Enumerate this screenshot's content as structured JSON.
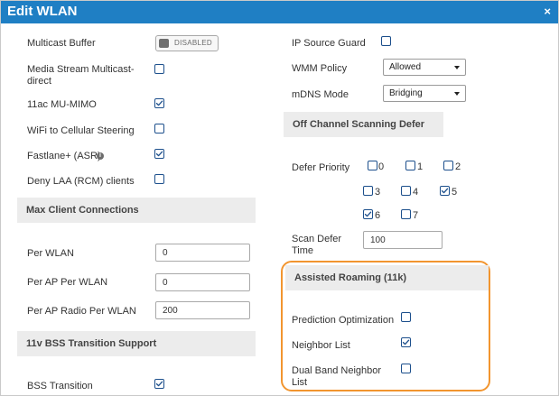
{
  "dialog": {
    "title": "Edit WLAN",
    "close_glyph": "×"
  },
  "left": {
    "multicast_buffer": {
      "label": "Multicast Buffer",
      "toggle_text": "DISABLED",
      "enabled": false
    },
    "media_stream": {
      "label": "Media Stream Multicast-direct",
      "checked": false
    },
    "mu_mimo": {
      "label": "11ac MU-MIMO",
      "checked": true
    },
    "wifi_cellular": {
      "label": "WiFi to Cellular Steering",
      "checked": false
    },
    "fastlane": {
      "label": "Fastlane+ (ASR)",
      "info_icon": "info-icon",
      "info_glyph": "i",
      "checked": true
    },
    "deny_laa": {
      "label": "Deny LAA (RCM) clients",
      "checked": false
    },
    "max_client_section": "Max Client Connections",
    "per_wlan": {
      "label": "Per WLAN",
      "value": "0"
    },
    "per_ap_per_wlan": {
      "label": "Per AP Per WLAN",
      "value": "0"
    },
    "per_ap_radio_per_wlan": {
      "label": "Per AP Radio Per WLAN",
      "value": "200"
    },
    "bss_section": "11v BSS Transition Support",
    "bss_transition": {
      "label": "BSS Transition",
      "checked": true
    }
  },
  "right": {
    "ip_source_guard": {
      "label": "IP Source Guard",
      "checked": false
    },
    "wmm_policy": {
      "label": "WMM Policy",
      "value": "Allowed"
    },
    "mdns_mode": {
      "label": "mDNS Mode",
      "value": "Bridging"
    },
    "off_channel_section": "Off Channel Scanning Defer",
    "defer_priority": {
      "label": "Defer Priority",
      "items": [
        {
          "num": "0",
          "checked": false
        },
        {
          "num": "1",
          "checked": false
        },
        {
          "num": "2",
          "checked": false
        },
        {
          "num": "3",
          "checked": false
        },
        {
          "num": "4",
          "checked": false
        },
        {
          "num": "5",
          "checked": true
        },
        {
          "num": "6",
          "checked": true
        },
        {
          "num": "7",
          "checked": false
        }
      ]
    },
    "scan_defer_time": {
      "label": "Scan Defer Time",
      "value": "100"
    },
    "assisted_roaming_section": "Assisted Roaming (11k)",
    "prediction_optimization": {
      "label": "Prediction Optimization",
      "checked": false
    },
    "neighbor_list": {
      "label": "Neighbor List",
      "checked": true
    },
    "dual_band_neighbor_list": {
      "label": "Dual Band Neighbor List",
      "checked": false
    }
  },
  "colors": {
    "titlebar": "#1f7fc4",
    "highlight": "#f2952f",
    "checkbox_border": "#1c4f8c",
    "section_bg": "#ececec"
  }
}
